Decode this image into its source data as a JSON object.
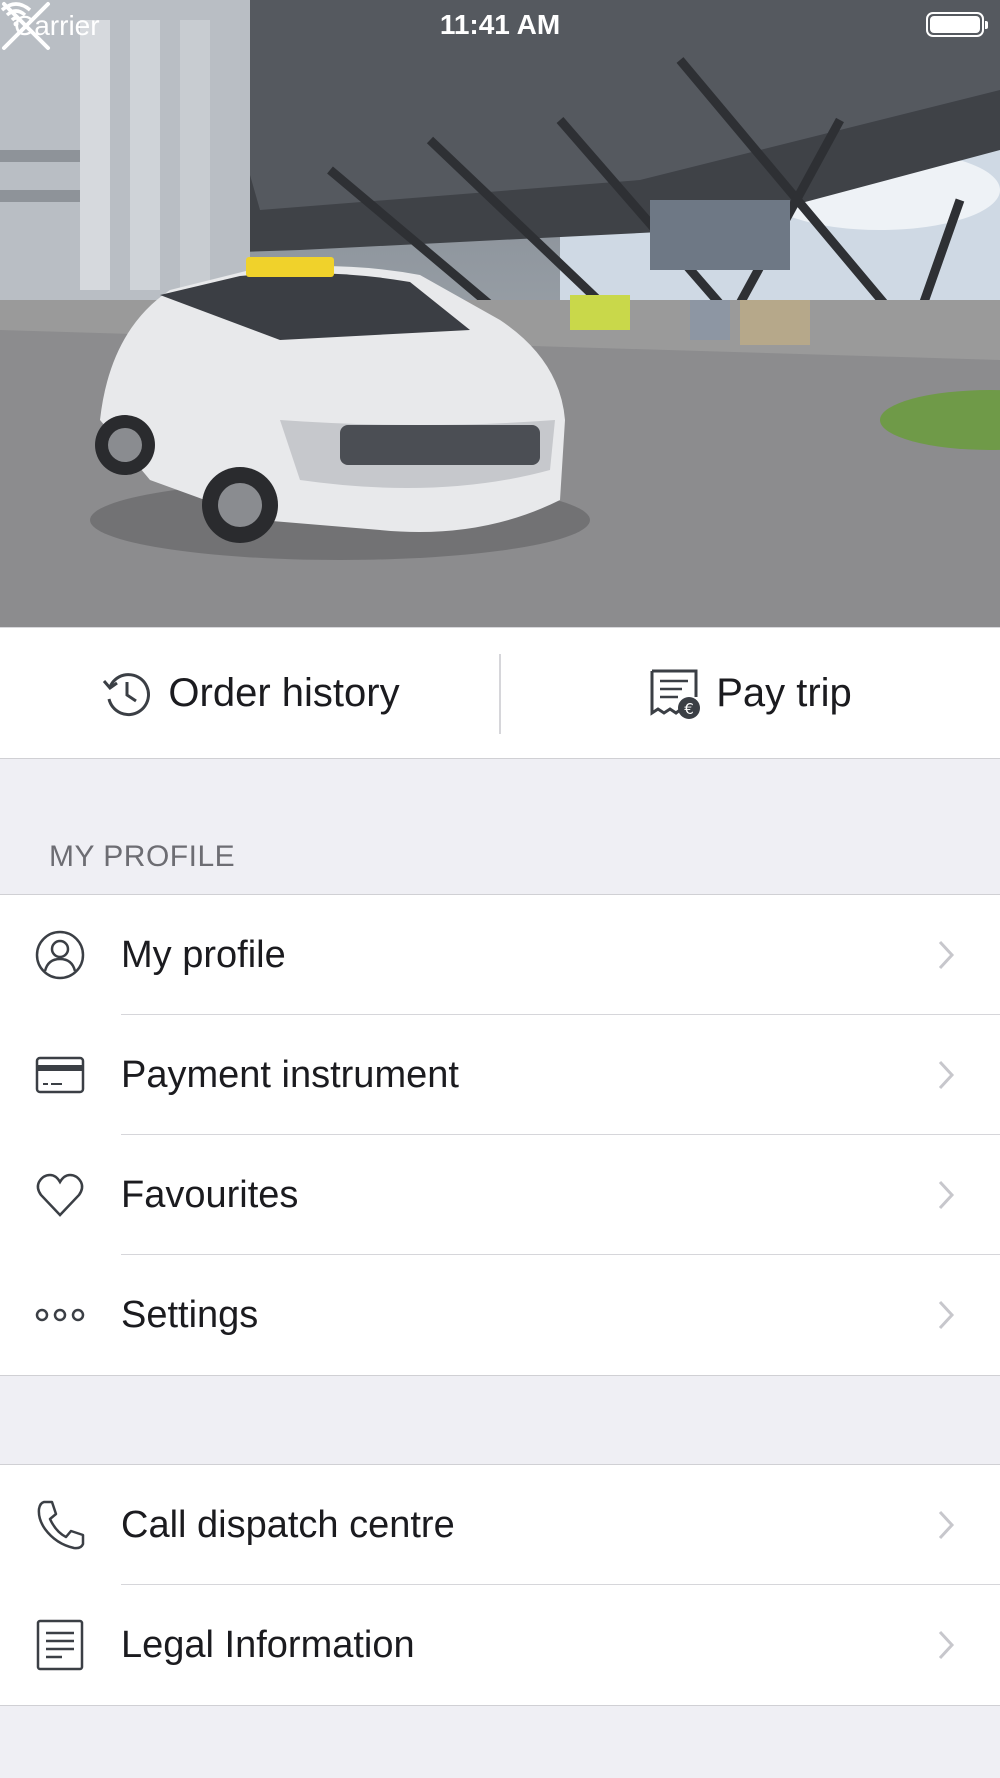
{
  "status_bar": {
    "carrier": "Carrier",
    "time": "11:41 AM"
  },
  "hero": {
    "image_description": "airport-taxi-photo"
  },
  "actions": {
    "order_history": "Order history",
    "pay_trip": "Pay trip"
  },
  "profile_section": {
    "header": "MY PROFILE",
    "items": [
      {
        "label": "My profile",
        "icon": "user-icon"
      },
      {
        "label": "Payment instrument",
        "icon": "credit-card-icon"
      },
      {
        "label": "Favourites",
        "icon": "heart-icon"
      },
      {
        "label": "Settings",
        "icon": "more-dots-icon"
      }
    ]
  },
  "info_section": {
    "items": [
      {
        "label": "Call dispatch centre",
        "icon": "phone-icon"
      },
      {
        "label": "Legal Information",
        "icon": "document-icon"
      }
    ]
  },
  "colors": {
    "icon": "#3b3f45",
    "chevron": "#c7c7cc",
    "background": "#efeff4"
  }
}
